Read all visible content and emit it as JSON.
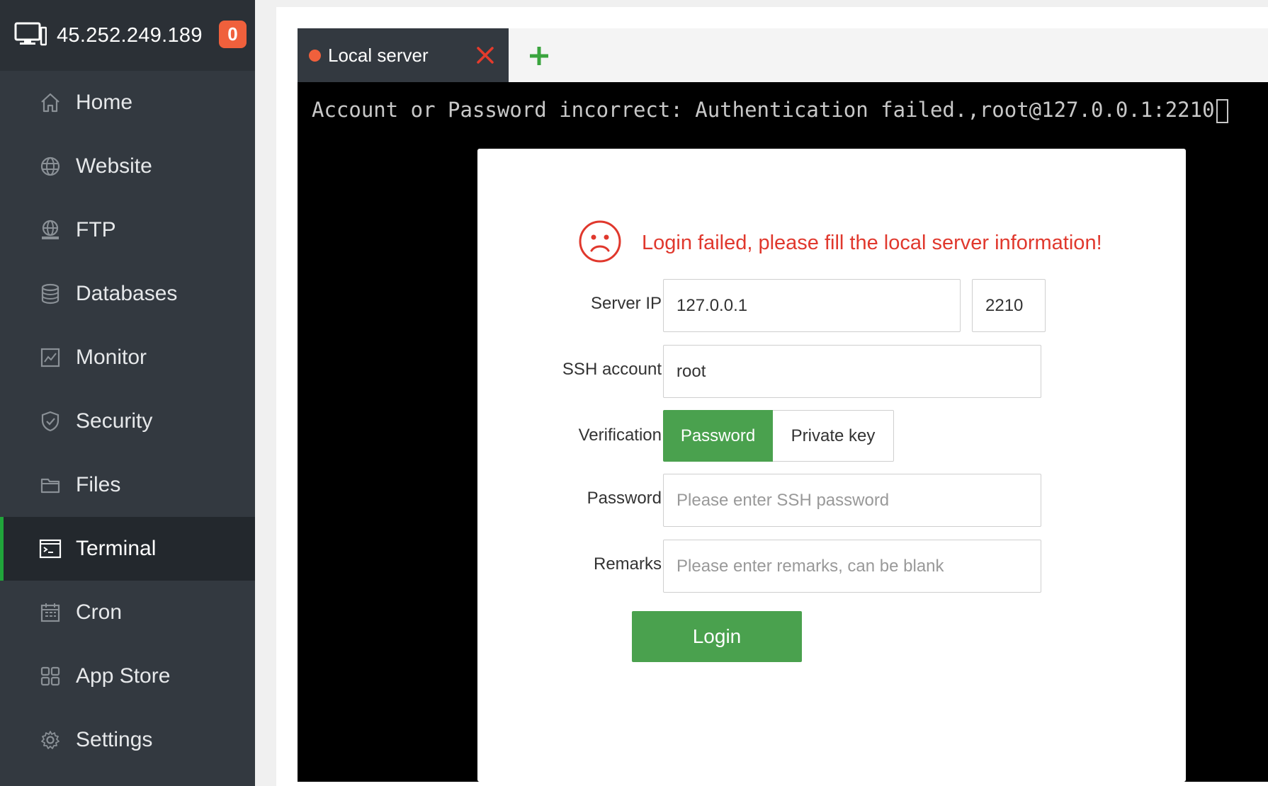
{
  "sidebar": {
    "host": "45.252.249.189",
    "badge": "0",
    "items": [
      {
        "label": "Home",
        "icon": "home-icon"
      },
      {
        "label": "Website",
        "icon": "globe-icon"
      },
      {
        "label": "FTP",
        "icon": "ftp-globe-icon"
      },
      {
        "label": "Databases",
        "icon": "database-icon"
      },
      {
        "label": "Monitor",
        "icon": "monitor-chart-icon"
      },
      {
        "label": "Security",
        "icon": "shield-icon"
      },
      {
        "label": "Files",
        "icon": "folder-icon"
      },
      {
        "label": "Terminal",
        "icon": "terminal-icon",
        "active": true
      },
      {
        "label": "Cron",
        "icon": "calendar-icon"
      },
      {
        "label": "App Store",
        "icon": "grid-icon"
      },
      {
        "label": "Settings",
        "icon": "gear-icon"
      }
    ]
  },
  "tabs": {
    "active_label": "Local server",
    "add_icon": "plus-icon",
    "close_icon": "close-icon"
  },
  "terminal": {
    "output": "Account or Password incorrect: Authentication failed.,root@127.0.0.1:2210"
  },
  "dialog": {
    "error_message": "Login failed, please fill the local server information!",
    "server_ip_label": "Server IP",
    "server_ip_value": "127.0.0.1",
    "port_value": "2210",
    "ssh_account_label": "SSH account",
    "ssh_account_value": "root",
    "verification_label": "Verification",
    "verification_options": [
      "Password",
      "Private key"
    ],
    "password_label": "Password",
    "password_placeholder": "Please enter SSH password",
    "remarks_label": "Remarks",
    "remarks_placeholder": "Please enter remarks, can be blank",
    "login_label": "Login"
  },
  "colors": {
    "sidebar_bg": "#333940",
    "accent_green": "#4aa14e",
    "error_red": "#e0382d",
    "badge_orange": "#f0603c"
  }
}
